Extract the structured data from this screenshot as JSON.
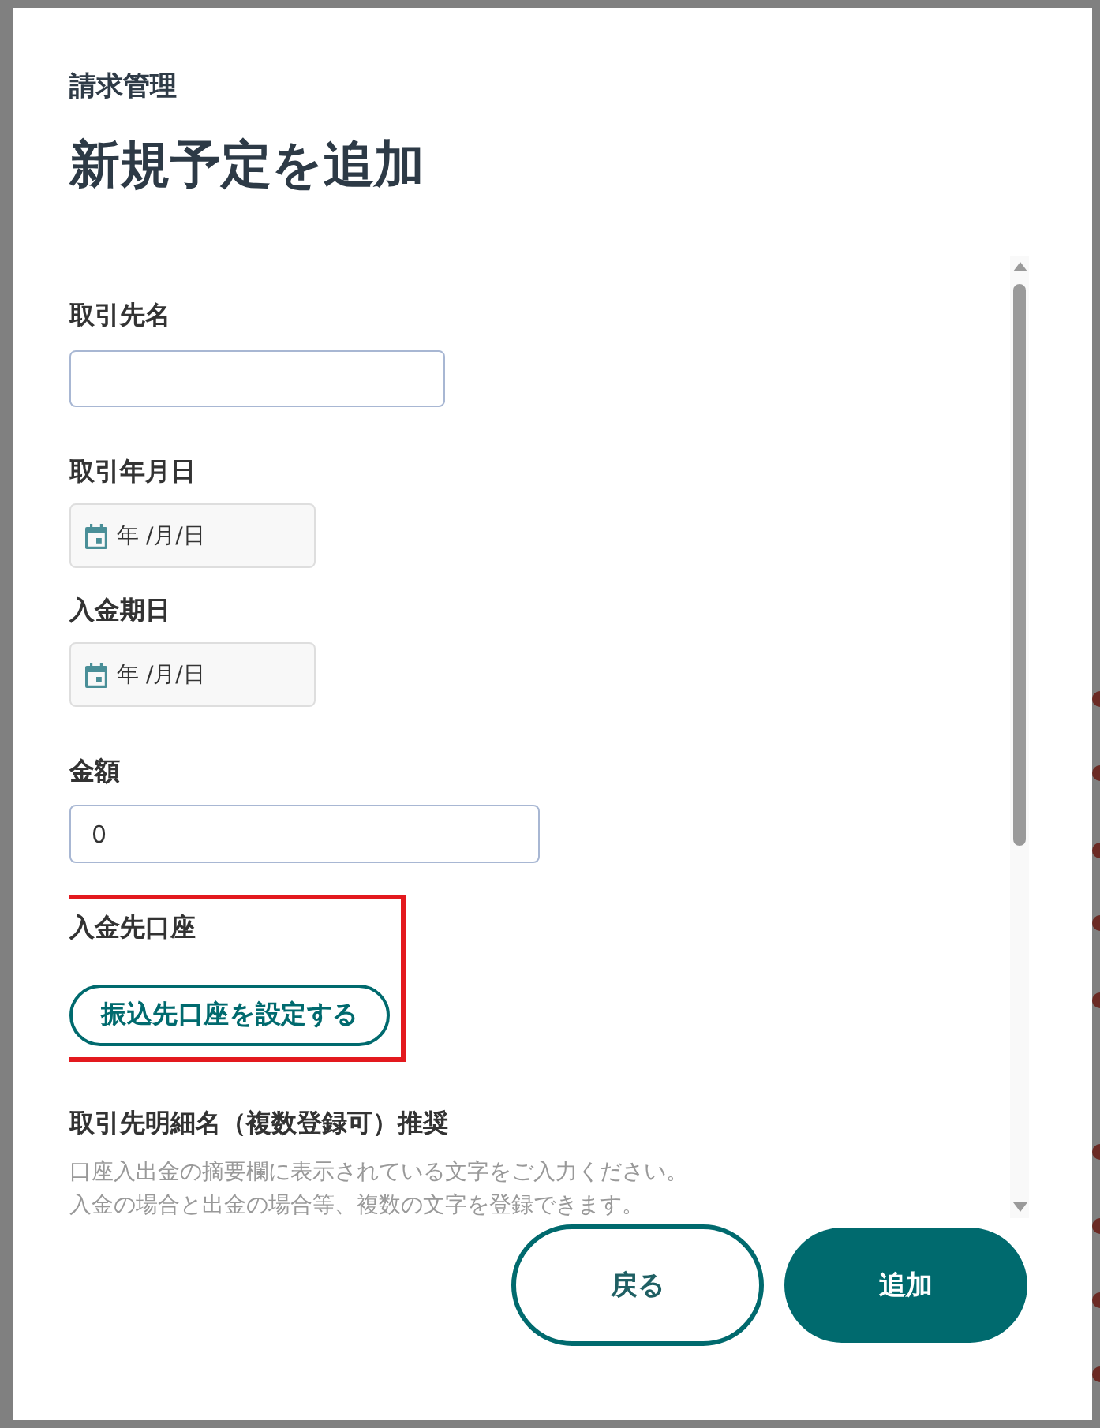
{
  "dialog": {
    "category": "請求管理",
    "title": "新規予定を追加"
  },
  "form": {
    "fields": [
      {
        "kind": "text",
        "label": "取引先名"
      },
      {
        "kind": "date",
        "label": "取引年月日",
        "placeholder": "年 /月/日"
      },
      {
        "kind": "date",
        "label": "入金期日",
        "placeholder": "年 /月/日"
      },
      {
        "kind": "number",
        "label": "金額",
        "value": "0"
      },
      {
        "kind": "account",
        "label": "入金先口座",
        "button": "振込先口座を設定する",
        "highlighted": true
      },
      {
        "kind": "note",
        "label": "取引先明細名（複数登録可）推奨",
        "help": [
          "口座入出金の摘要欄に表示されている文字をご入力ください。",
          "入金の場合と出金の場合等、複数の文字を登録できます。"
        ]
      }
    ]
  },
  "buttons": [
    {
      "kind": "secondary",
      "label": "戻る"
    },
    {
      "kind": "primary",
      "label": "追加"
    }
  ]
}
